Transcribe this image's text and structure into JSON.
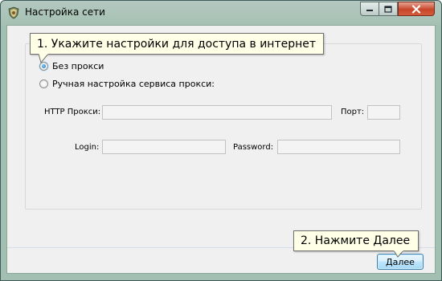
{
  "window": {
    "title": "Настройка сети",
    "icon": "shield-crest-icon",
    "controls": [
      "minimize-icon",
      "maximize-icon",
      "close-icon"
    ]
  },
  "callouts": {
    "step1": "1. Укажите настройки для доступа в интернет",
    "step2": "2. Нажмите Далее"
  },
  "proxy": {
    "options": [
      {
        "label": "Без прокси",
        "selected": true
      },
      {
        "label": "Ручная настройка сервиса прокси:",
        "selected": false
      }
    ],
    "http_label": "HTTP Прокси:",
    "http_value": "",
    "port_label": "Порт:",
    "port_value": "",
    "login_label": "Login:",
    "login_value": "",
    "password_label": "Password:",
    "password_value": ""
  },
  "footer": {
    "next_label": "Далее"
  },
  "colors": {
    "frame": "#a3bfb1",
    "client_bg": "#f0f0f0",
    "callout_bg": "#ffffe7",
    "close_button": "#c7462a",
    "button_border": "#3c7fb1"
  }
}
